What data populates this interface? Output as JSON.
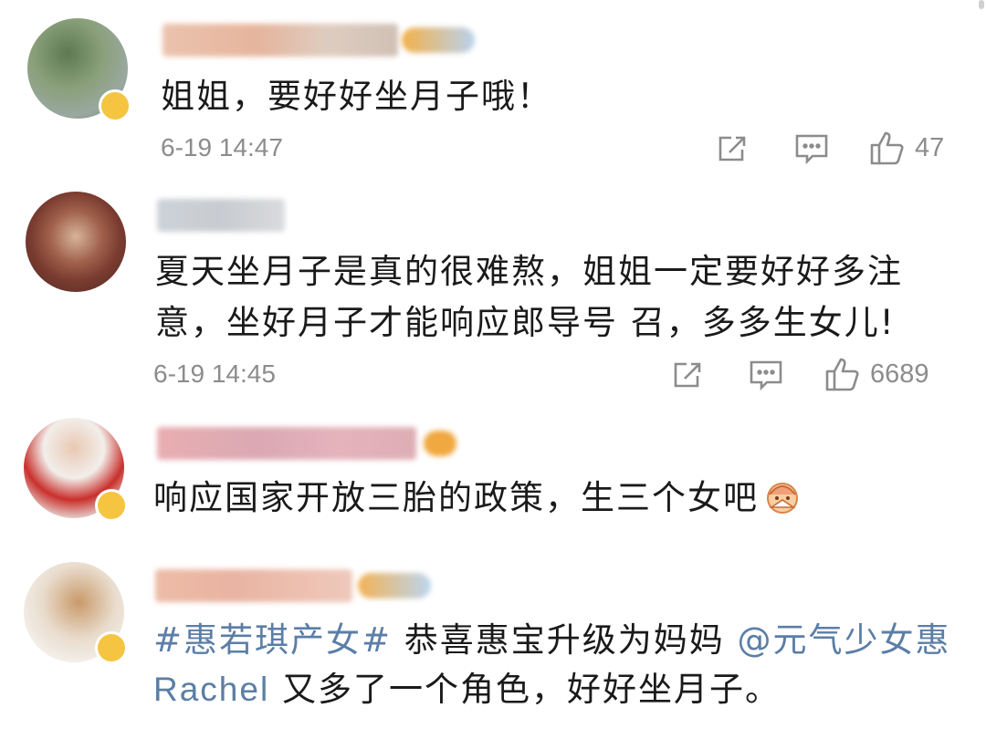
{
  "colors": {
    "text": "#1a1a1a",
    "meta": "#8c8c8c",
    "topic_link": "#5b7ea6",
    "vip_badge": "#f5c542"
  },
  "comments": [
    {
      "text_lines": [
        "姐姐，要好好坐月子哦！"
      ],
      "time": "6-19 14:47",
      "likes": "47",
      "icons": [
        "share-icon",
        "comment-icon",
        "like-icon"
      ]
    },
    {
      "text_lines": [
        "夏天坐月子是真的很难熬，姐姐一定要好好多注",
        "意，坐好月子才能响应郎导号 召，多多生女儿!"
      ],
      "time": "6-19 14:45",
      "likes": "6689",
      "icons": [
        "share-icon",
        "comment-icon",
        "like-icon"
      ]
    },
    {
      "text_lines": [
        "响应国家开放三胎的政策，生三个女吧"
      ],
      "emoji": "fan-face-emoji"
    },
    {
      "topic": "#惠若琪产女#",
      "line1_rest": " 恭喜惠宝升级为妈妈 ",
      "mention_a": "@元气少女惠",
      "mention_b": "Rachel",
      "line2_rest": "  又多了一个角色，好好坐月子。"
    }
  ]
}
